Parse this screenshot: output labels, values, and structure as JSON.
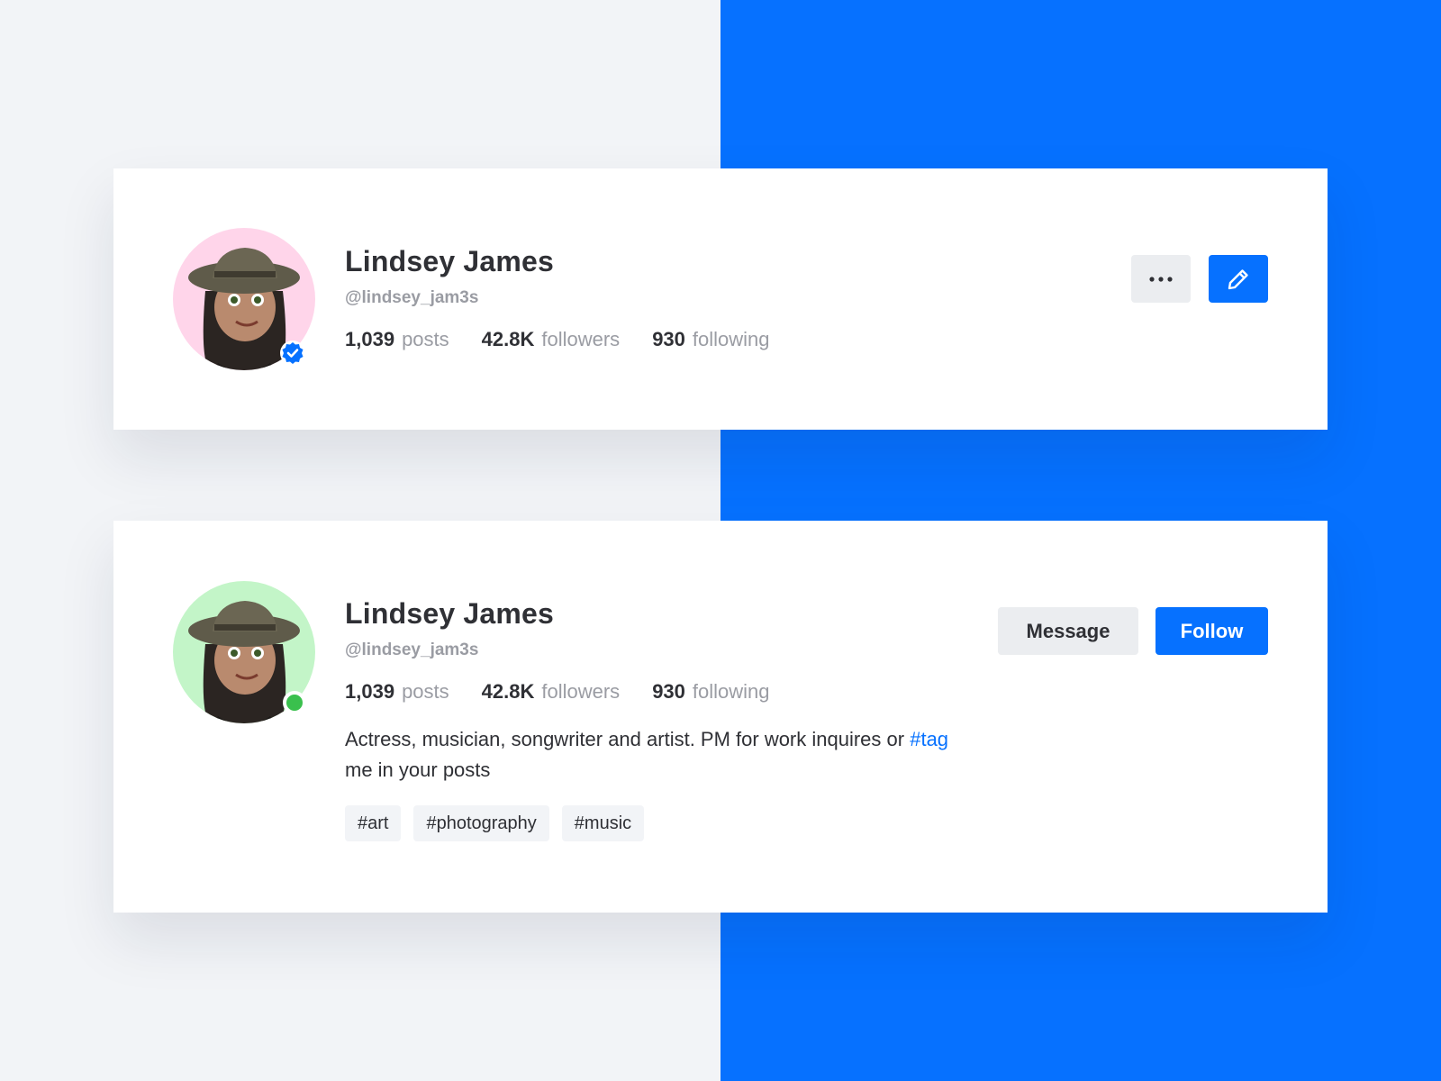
{
  "colors": {
    "accent": "#0671ff",
    "page_bg": "#f2f4f7",
    "online": "#3ac04d",
    "avatar_bg_pink": "#ffd5ea",
    "avatar_bg_green": "#c3f5c8"
  },
  "card1": {
    "name": "Lindsey James",
    "handle": "@lindsey_jam3s",
    "avatar_icon": "memoji-avatar",
    "badge_icon": "verified-badge-icon",
    "stats": [
      {
        "num": "1,039",
        "label": "posts"
      },
      {
        "num": "42.8K",
        "label": "followers"
      },
      {
        "num": "930",
        "label": "following"
      }
    ],
    "buttons": {
      "more_icon": "more-horizontal-icon",
      "edit_icon": "pencil-icon"
    }
  },
  "card2": {
    "name": "Lindsey James",
    "handle": "@lindsey_jam3s",
    "avatar_icon": "memoji-avatar",
    "status": "online",
    "stats": [
      {
        "num": "1,039",
        "label": "posts"
      },
      {
        "num": "42.8K",
        "label": "followers"
      },
      {
        "num": "930",
        "label": "following"
      }
    ],
    "bio": {
      "before": "Actress, musician, songwriter and artist. PM for work inquires or ",
      "link": "#tag",
      "after": " me in your posts"
    },
    "tags": [
      "#art",
      "#photography",
      "#music"
    ],
    "buttons": {
      "message": "Message",
      "follow": "Follow"
    }
  }
}
